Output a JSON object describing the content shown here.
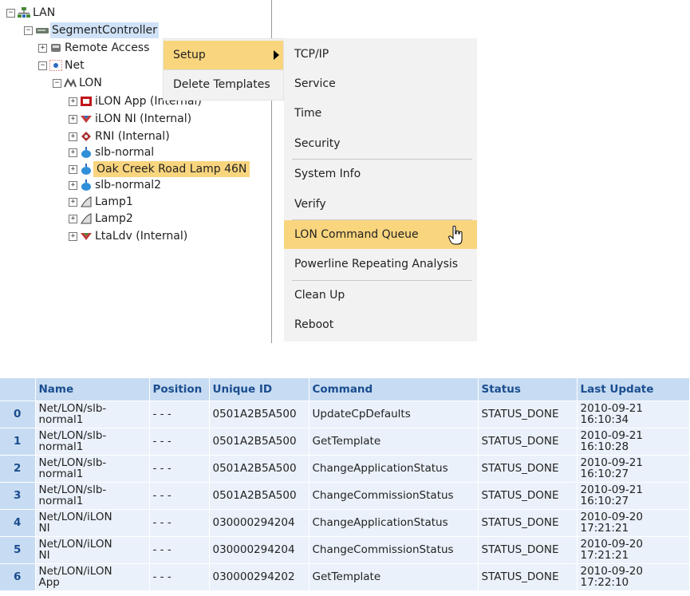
{
  "tree": {
    "lan": "LAN",
    "segment_controller": "SegmentController",
    "remote_access": "Remote Access",
    "net": "Net",
    "lon": "LON",
    "ilon_app": "iLON App (Internal)",
    "ilon_ni": "iLON NI (Internal)",
    "rni": "RNI (Internal)",
    "slb_normal": "slb-normal",
    "oak_creek": "Oak Creek Road Lamp 46N",
    "slb_normal2": "slb-normal2",
    "lamp1": "Lamp1",
    "lamp2": "Lamp2",
    "ltaldv": "LtaLdv (Internal)",
    "expand_glyph": "+",
    "collapse_glyph": "−"
  },
  "context_menu": {
    "setup": "Setup",
    "delete_templates": "Delete Templates"
  },
  "setup_submenu": {
    "tcpip": "TCP/IP",
    "service": "Service",
    "time": "Time",
    "security": "Security",
    "system_info": "System Info",
    "verify": "Verify",
    "lon_command_queue": "LON Command Queue",
    "powerline": "Powerline Repeating Analysis",
    "clean_up": "Clean Up",
    "reboot": "Reboot"
  },
  "queue_table": {
    "headers": [
      "Name",
      "Position",
      "Unique ID",
      "Command",
      "Status",
      "Last Update"
    ],
    "rows": [
      {
        "idx": "0",
        "name1": "Net/LON/slb-",
        "name2": "normal1",
        "position": "- - -",
        "uid": "0501A2B5A500",
        "command": "UpdateCpDefaults",
        "status": "STATUS_DONE",
        "date": "2010-09-21",
        "time": "16:10:34"
      },
      {
        "idx": "1",
        "name1": "Net/LON/slb-",
        "name2": "normal1",
        "position": "- - -",
        "uid": "0501A2B5A500",
        "command": "GetTemplate",
        "status": "STATUS_DONE",
        "date": "2010-09-21",
        "time": "16:10:28"
      },
      {
        "idx": "2",
        "name1": "Net/LON/slb-",
        "name2": "normal1",
        "position": "- - -",
        "uid": "0501A2B5A500",
        "command": "ChangeApplicationStatus",
        "status": "STATUS_DONE",
        "date": "2010-09-21",
        "time": "16:10:27"
      },
      {
        "idx": "3",
        "name1": "Net/LON/slb-",
        "name2": "normal1",
        "position": "- - -",
        "uid": "0501A2B5A500",
        "command": "ChangeCommissionStatus",
        "status": "STATUS_DONE",
        "date": "2010-09-21",
        "time": "16:10:27"
      },
      {
        "idx": "4",
        "name1": "Net/LON/iLON",
        "name2": "NI",
        "position": "- - -",
        "uid": "030000294204",
        "command": "ChangeApplicationStatus",
        "status": "STATUS_DONE",
        "date": "2010-09-20",
        "time": "17:21:21"
      },
      {
        "idx": "5",
        "name1": "Net/LON/iLON",
        "name2": "NI",
        "position": "- - -",
        "uid": "030000294204",
        "command": "ChangeCommissionStatus",
        "status": "STATUS_DONE",
        "date": "2010-09-20",
        "time": "17:21:21"
      },
      {
        "idx": "6",
        "name1": "Net/LON/iLON",
        "name2": "App",
        "position": "- - -",
        "uid": "030000294202",
        "command": "GetTemplate",
        "status": "STATUS_DONE",
        "date": "2010-09-20",
        "time": "17:22:10"
      }
    ]
  },
  "colors": {
    "highlight": "#f9d57e",
    "header_bg": "#c7dcf2",
    "header_text": "#1b4d8f",
    "selection": "#cfe2f7"
  }
}
